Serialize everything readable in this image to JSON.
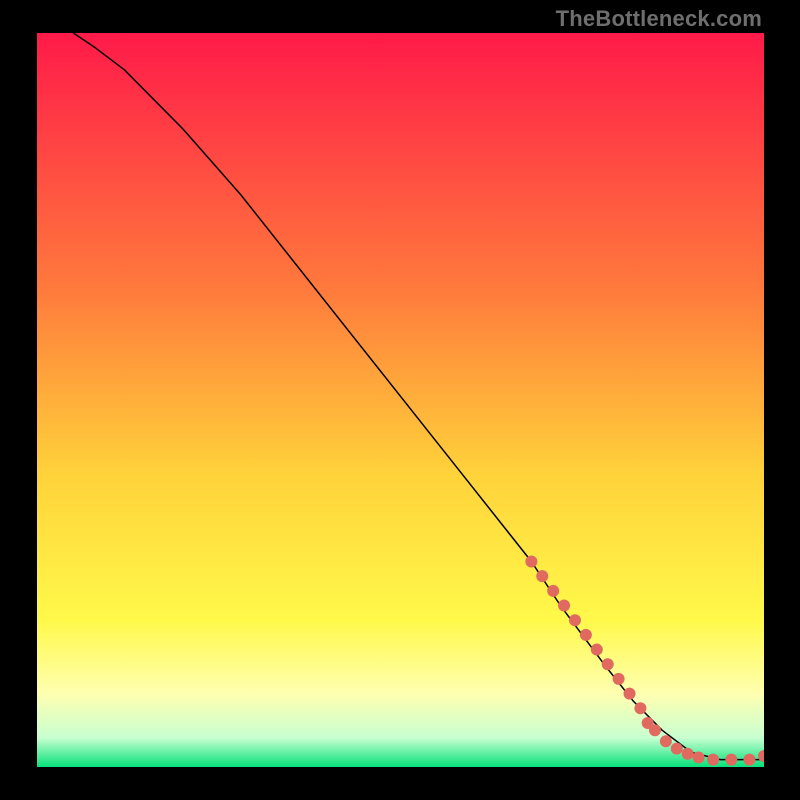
{
  "watermark": "TheBottleneck.com",
  "chart_data": {
    "type": "line",
    "title": "",
    "xlabel": "",
    "ylabel": "",
    "xlim": [
      0,
      100
    ],
    "ylim": [
      0,
      100
    ],
    "gradient_stops": [
      {
        "pos": 0.0,
        "color": "#ff1a49"
      },
      {
        "pos": 0.35,
        "color": "#ff7a3c"
      },
      {
        "pos": 0.6,
        "color": "#ffd23a"
      },
      {
        "pos": 0.8,
        "color": "#fff94a"
      },
      {
        "pos": 0.9,
        "color": "#ffffb0"
      },
      {
        "pos": 0.96,
        "color": "#c8ffd0"
      },
      {
        "pos": 1.0,
        "color": "#06e27a"
      }
    ],
    "series": [
      {
        "name": "curve",
        "type": "line",
        "color": "#000000",
        "stroke_width": 1.5,
        "x": [
          5,
          8,
          12,
          16,
          20,
          28,
          36,
          44,
          52,
          60,
          68,
          72,
          78,
          82,
          86,
          90,
          94,
          98,
          100
        ],
        "y": [
          100,
          98,
          95,
          91,
          87,
          78,
          68,
          58,
          48,
          38,
          28,
          22,
          14,
          9,
          5,
          2,
          1,
          1,
          1
        ]
      },
      {
        "name": "markers",
        "type": "scatter",
        "color": "#e06a5f",
        "radius": 6,
        "x": [
          68,
          69.5,
          71,
          72.5,
          74,
          75.5,
          77,
          78.5,
          80,
          81.5,
          83,
          84,
          85,
          86.5,
          88,
          89.5,
          91,
          93,
          95.5,
          98,
          100
        ],
        "y": [
          28,
          26,
          24,
          22,
          20,
          18,
          16,
          14,
          12,
          10,
          8,
          6,
          5,
          3.5,
          2.5,
          1.8,
          1.3,
          1,
          1,
          1,
          1.5
        ]
      }
    ]
  }
}
